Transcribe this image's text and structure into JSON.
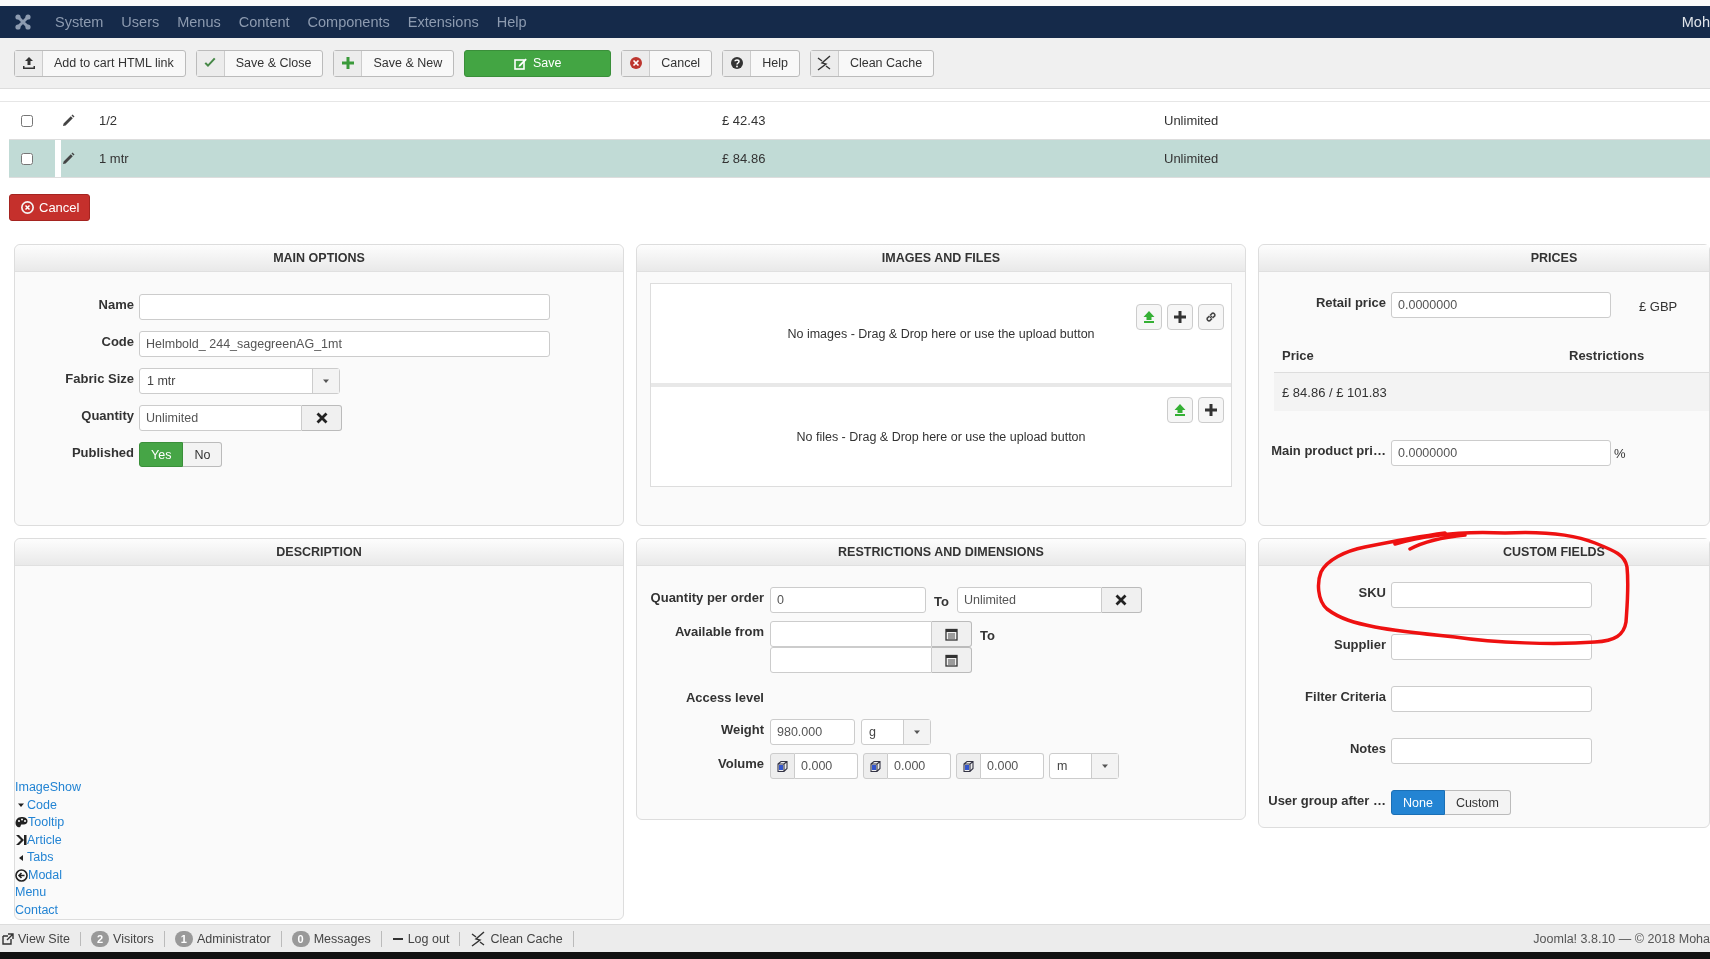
{
  "navbar": {
    "menu": [
      "System",
      "Users",
      "Menus",
      "Content",
      "Components",
      "Extensions",
      "Help"
    ],
    "user": "Moh"
  },
  "toolbar": [
    {
      "label": "Add to cart HTML link",
      "kind": "upload"
    },
    {
      "label": "Save & Close",
      "kind": "check"
    },
    {
      "label": "Save & New",
      "kind": "plus"
    },
    {
      "label": "Save",
      "kind": "primary"
    },
    {
      "label": "Cancel",
      "kind": "cancel"
    },
    {
      "label": "Help",
      "kind": "help"
    },
    {
      "label": "Clean Cache",
      "kind": "clean"
    }
  ],
  "variants": [
    {
      "checked": false,
      "selected": false,
      "name": "1/2",
      "price": "£ 42.43",
      "stock": "Unlimited"
    },
    {
      "checked": false,
      "selected": true,
      "name": "1 mtr",
      "price": "£ 84.86",
      "stock": "Unlimited"
    }
  ],
  "cancel_button": "Cancel",
  "main_options": {
    "title": "MAIN OPTIONS",
    "fields": [
      {
        "label": "Name",
        "kind": "text"
      },
      {
        "label": "Code",
        "kind": "text",
        "value": "Helmbold_ 244_sagegreenAG_1mt"
      },
      {
        "label": "Fabric Size",
        "kind": "select",
        "value": "1 mtr"
      },
      {
        "label": "Quantity",
        "kind": "clearable",
        "value": "Unlimited"
      },
      {
        "label": "Published",
        "kind": "toggle",
        "options": [
          {
            "label": "Yes",
            "selected": true
          },
          {
            "label": "No",
            "selected": false
          }
        ]
      }
    ]
  },
  "images_and_files": {
    "title": "IMAGES AND FILES",
    "zones": [
      {
        "text": "No images - Drag & Drop here or use the upload button",
        "actions": [
          {
            "kind": "upload"
          },
          {
            "kind": "add"
          },
          {
            "kind": "link"
          }
        ]
      },
      {
        "text": "No files - Drag & Drop here or use the upload button",
        "actions": [
          {
            "kind": "upload"
          },
          {
            "kind": "add"
          }
        ]
      }
    ]
  },
  "prices": {
    "title": "PRICES",
    "retail": {
      "label": "Retail price",
      "value": "0.0000000",
      "currency": "£ GBP"
    },
    "columns": [
      "Price",
      "Restrictions"
    ],
    "rows": [
      [
        "£ 84.86 / £ 101.83"
      ]
    ],
    "main": {
      "label": "Main product pri…",
      "value": "0.0000000",
      "unit": "%"
    }
  },
  "description": {
    "title": "DESCRIPTION",
    "links": [
      {
        "text": "ImageShow",
        "kind": "plain"
      },
      {
        "text": "Code",
        "kind": "caret-down"
      },
      {
        "text": "Tooltip",
        "kind": "palette"
      },
      {
        "text": "Article",
        "kind": "chevron"
      },
      {
        "text": "Tabs",
        "kind": "caret-left"
      },
      {
        "text": "Modal",
        "kind": "circle-arrow"
      },
      {
        "text": "Menu",
        "kind": "plain"
      },
      {
        "text": "Contact",
        "kind": "plain"
      }
    ]
  },
  "restrictions": {
    "title": "RESTRICTIONS AND DIMENSIONS",
    "quantity": {
      "label": "Quantity per order",
      "from": "0",
      "to_label": "To",
      "to": "Unlimited"
    },
    "available": {
      "label": "Available from",
      "to_label": "To"
    },
    "access_label": "Access level",
    "weight": {
      "label": "Weight",
      "value": "980.000",
      "unit": "g"
    },
    "volume": {
      "label": "Volume",
      "values": [
        "0.000",
        "0.000",
        "0.000"
      ],
      "unit": "m"
    }
  },
  "custom_fields": {
    "title": "CUSTOM FIELDS",
    "fields": [
      {
        "label": "SKU",
        "kind": "text"
      },
      {
        "label": "Supplier",
        "kind": "text"
      },
      {
        "label": "Filter Criteria",
        "kind": "text"
      },
      {
        "label": "Notes",
        "kind": "text"
      },
      {
        "label": "User group after …",
        "kind": "toggle",
        "options": [
          {
            "label": "None",
            "selected": true
          },
          {
            "label": "Custom",
            "selected": false
          }
        ]
      }
    ],
    "annotation": {
      "kind": "freehand-loop"
    }
  },
  "status_bar": {
    "items": [
      {
        "kind": "external",
        "text": "View Site"
      },
      {
        "kind": "count",
        "count": "2",
        "text": "Visitors"
      },
      {
        "kind": "count",
        "count": "1",
        "text": "Administrator"
      },
      {
        "kind": "count",
        "count": "0",
        "text": "Messages"
      },
      {
        "kind": "logout",
        "text": "Log out"
      },
      {
        "kind": "clean",
        "text": "Clean Cache"
      }
    ],
    "version": "Joomla! 3.8.10 — © 2018 Moha"
  }
}
